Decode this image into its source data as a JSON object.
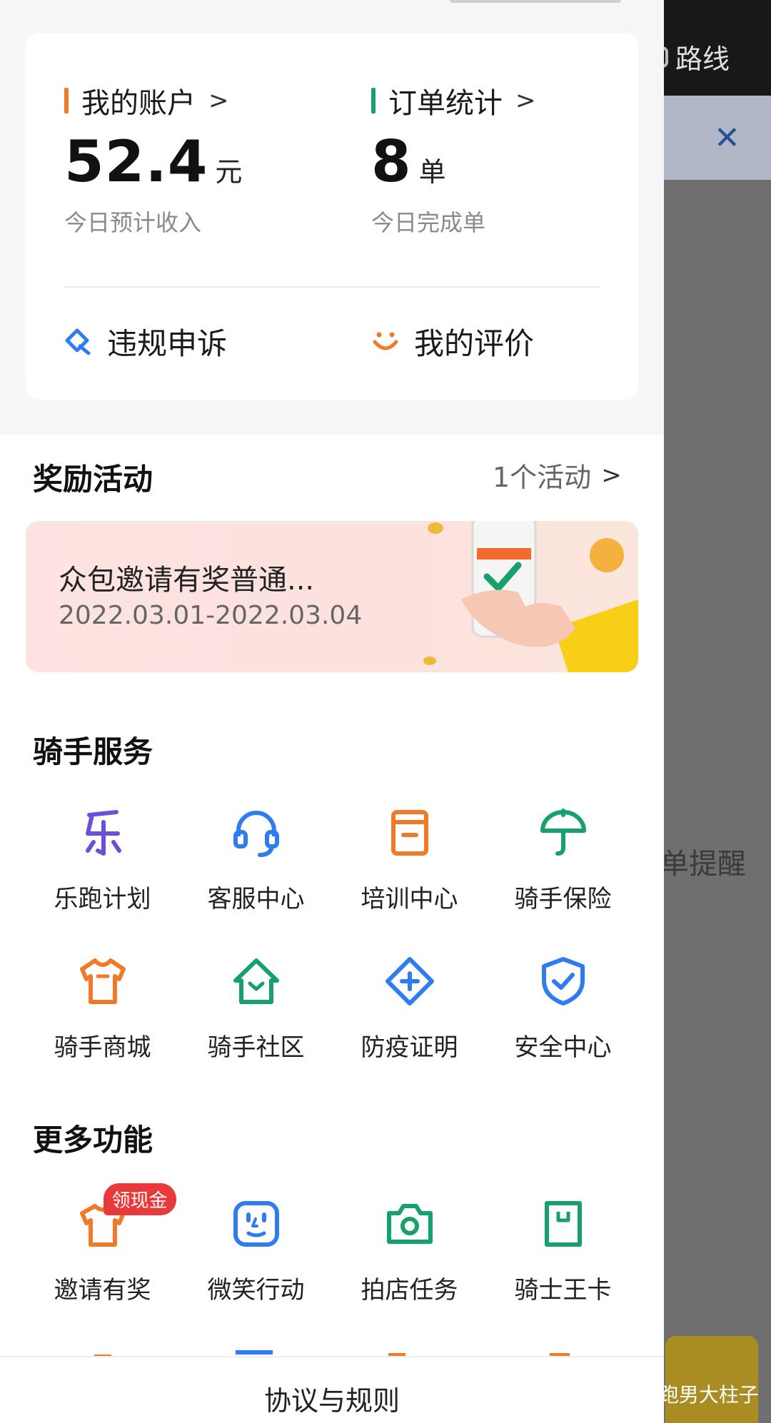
{
  "background": {
    "route_label": "路线",
    "remind_label": "单提醒",
    "watermark": "头条 @跑男大柱子"
  },
  "account": {
    "title": "我的账户",
    "value": "52.4",
    "unit": "元",
    "subtitle": "今日预计收入"
  },
  "orders": {
    "title": "订单统计",
    "value": "8",
    "unit": "单",
    "subtitle": "今日完成单"
  },
  "quick_links": {
    "appeal": "违规申诉",
    "rating": "我的评价"
  },
  "rewards": {
    "title": "奖励活动",
    "count": "1个活动",
    "promo_title": "众包邀请有奖普通...",
    "promo_date": "2022.03.01-2022.03.04"
  },
  "rider_services": {
    "title": "骑手服务",
    "items": [
      {
        "label": "乐跑计划",
        "icon": "le-icon",
        "color": "#6d4fd8"
      },
      {
        "label": "客服中心",
        "icon": "headset-icon",
        "color": "#2f7cf0"
      },
      {
        "label": "培训中心",
        "icon": "book-icon",
        "color": "#ef7a2a"
      },
      {
        "label": "骑手保险",
        "icon": "umbrella-icon",
        "color": "#16a06a"
      },
      {
        "label": "骑手商城",
        "icon": "tshirt-icon",
        "color": "#ef7a2a"
      },
      {
        "label": "骑手社区",
        "icon": "home-icon",
        "color": "#16a06a"
      },
      {
        "label": "防疫证明",
        "icon": "medical-icon",
        "color": "#2f7cf0"
      },
      {
        "label": "安全中心",
        "icon": "shield-icon",
        "color": "#2f7cf0"
      }
    ]
  },
  "more_features": {
    "title": "更多功能",
    "items": [
      {
        "label": "邀请有奖",
        "icon": "gift-icon",
        "badge": "领现金",
        "color": "#ef7a2a"
      },
      {
        "label": "微笑行动",
        "icon": "smile-face-icon",
        "color": "#2f7cf0"
      },
      {
        "label": "拍店任务",
        "icon": "camera-icon",
        "color": "#16a06a"
      },
      {
        "label": "骑士王卡",
        "icon": "sim-card-icon",
        "color": "#16a06a"
      }
    ]
  },
  "footer": {
    "label": "协议与规则"
  }
}
